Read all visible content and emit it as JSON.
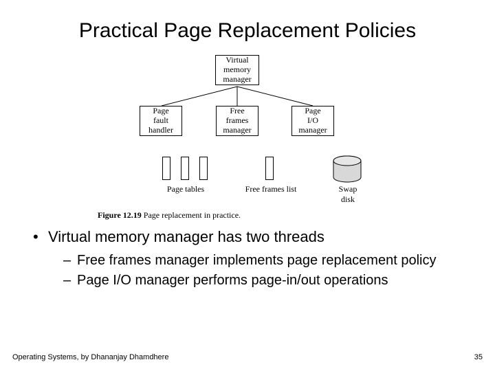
{
  "title": "Practical Page Replacement Policies",
  "figure": {
    "vm_manager": "Virtual\nmemory\nmanager",
    "page_fault_handler": "Page\nfault\nhandler",
    "free_frames_manager": "Free\nframes\nmanager",
    "page_io_manager": "Page\nI/O\nmanager",
    "page_tables_label": "Page tables",
    "free_frames_list_label": "Free frames list",
    "swap_disk_label": "Swap\ndisk",
    "caption_prefix": "Figure 12.19",
    "caption_text": "Page replacement in practice."
  },
  "bullets": {
    "main": "Virtual memory manager has two threads",
    "sub1": "Free frames manager implements page replacement policy",
    "sub2": "Page I/O manager performs page-in/out operations"
  },
  "footer": {
    "credit": "Operating Systems, by Dhananjay Dhamdhere",
    "page_number": "35"
  }
}
